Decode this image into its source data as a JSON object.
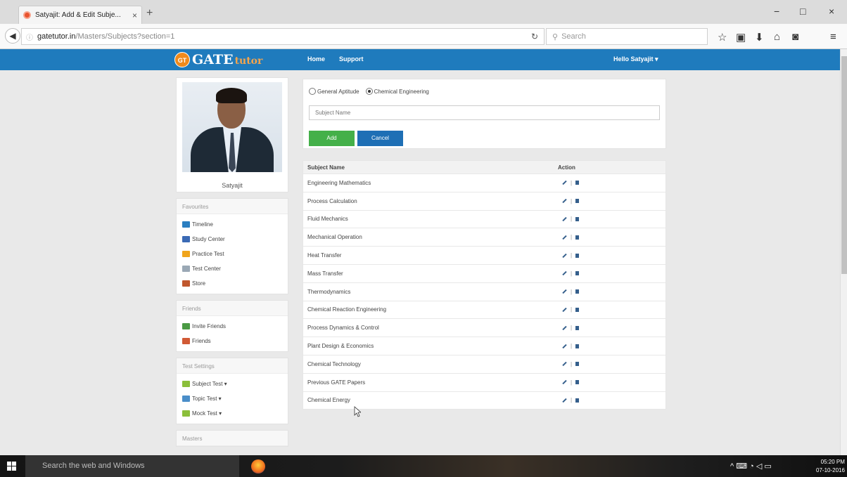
{
  "browser": {
    "tab_title": "Satyajit: Add & Edit Subje...",
    "tab_close": "×",
    "new_tab": "+",
    "url_host": "gatetutor.in",
    "url_path": "/Masters/Subjects?section=1",
    "search_placeholder": "Search",
    "window_controls": [
      "−",
      "□",
      "×"
    ],
    "toolbar_icons": [
      "star-icon",
      "clipboard-icon",
      "download-icon",
      "home-icon",
      "pocket-icon",
      "menu-icon"
    ]
  },
  "site": {
    "logo_badge": "GT",
    "logo_gate": "GATE",
    "logo_tutor": "tutor",
    "nav": [
      "Home",
      "Support"
    ],
    "greeting": "Hello Satyajit"
  },
  "profile": {
    "name": "Satyajit"
  },
  "sidebar": {
    "favourites": {
      "heading": "Favourites",
      "items": [
        {
          "label": "Timeline",
          "color": "#2b7fc1"
        },
        {
          "label": "Study Center",
          "color": "#3b6ab5"
        },
        {
          "label": "Practice Test",
          "color": "#f0a51c"
        },
        {
          "label": "Test Center",
          "color": "#9aa8b5"
        },
        {
          "label": "Store",
          "color": "#c0572d"
        }
      ]
    },
    "friends": {
      "heading": "Friends",
      "items": [
        {
          "label": "Invite Friends",
          "color": "#4a9a44"
        },
        {
          "label": "Friends",
          "color": "#d15a35"
        }
      ]
    },
    "test_settings": {
      "heading": "Test Settings",
      "items": [
        {
          "label": "Subject Test ▾",
          "color": "#8bbf3a"
        },
        {
          "label": "Topic Test ▾",
          "color": "#4a8ec9"
        },
        {
          "label": "Mock Test ▾",
          "color": "#8bbf3a"
        }
      ]
    },
    "masters": {
      "heading": "Masters"
    }
  },
  "form": {
    "radio_general": "General Aptitude",
    "radio_chemical": "Chemical Engineering",
    "selected": "Chemical Engineering",
    "subject_placeholder": "Subject Name",
    "add_label": "Add",
    "cancel_label": "Cancel"
  },
  "table": {
    "col_subject": "Subject Name",
    "col_action": "Action",
    "rows": [
      "Engineering Mathematics",
      "Process Calculation",
      "Fluid Mechanics",
      "Mechanical Operation",
      "Heat Transfer",
      "Mass Transfer",
      "Thermodynamics",
      "Chemical Reaction Engineering",
      "Process Dynamics & Control",
      "Plant Design & Economics",
      "Chemical Technology",
      "Previous GATE Papers",
      "Chemical Energy"
    ]
  },
  "taskbar": {
    "search_placeholder": "Search the web and Windows",
    "time": "05:20 PM",
    "date": "07-10-2016"
  }
}
